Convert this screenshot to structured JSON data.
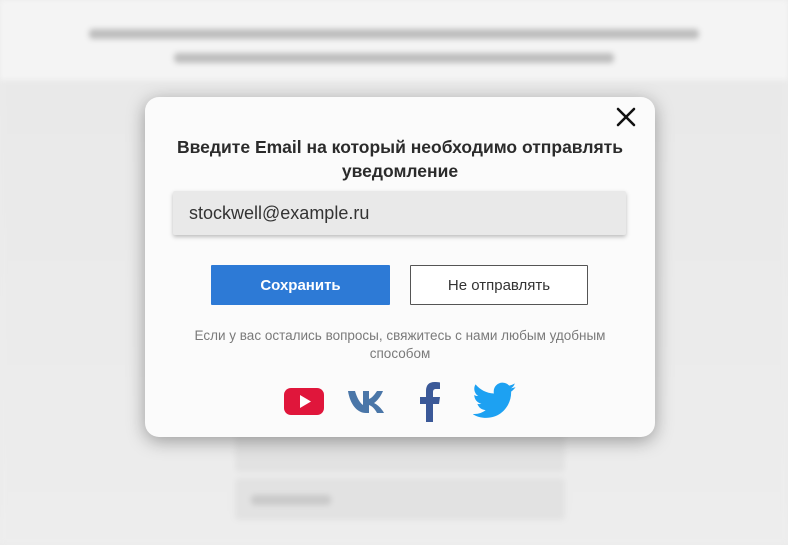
{
  "modal": {
    "title": "Введите Email на который необходимо отправлять уведомление",
    "email_value": "stockwell@example.ru",
    "save_label": "Сохранить",
    "skip_label": "Не отправлять",
    "contact_text": "Если у вас остались вопросы, свяжитесь с нами любым удобным способом",
    "close_icon": "close-icon"
  },
  "social": [
    {
      "icon": "youtube-icon",
      "color": "#e0163b"
    },
    {
      "icon": "vk-icon",
      "color": "#4a76a8"
    },
    {
      "icon": "facebook-icon",
      "color": "#3b5998"
    },
    {
      "icon": "twitter-icon",
      "color": "#1da1f2"
    }
  ],
  "colors": {
    "accent": "#2d7ad6",
    "modal_bg": "#fbfbfb",
    "input_bg": "#e9e9e9"
  }
}
